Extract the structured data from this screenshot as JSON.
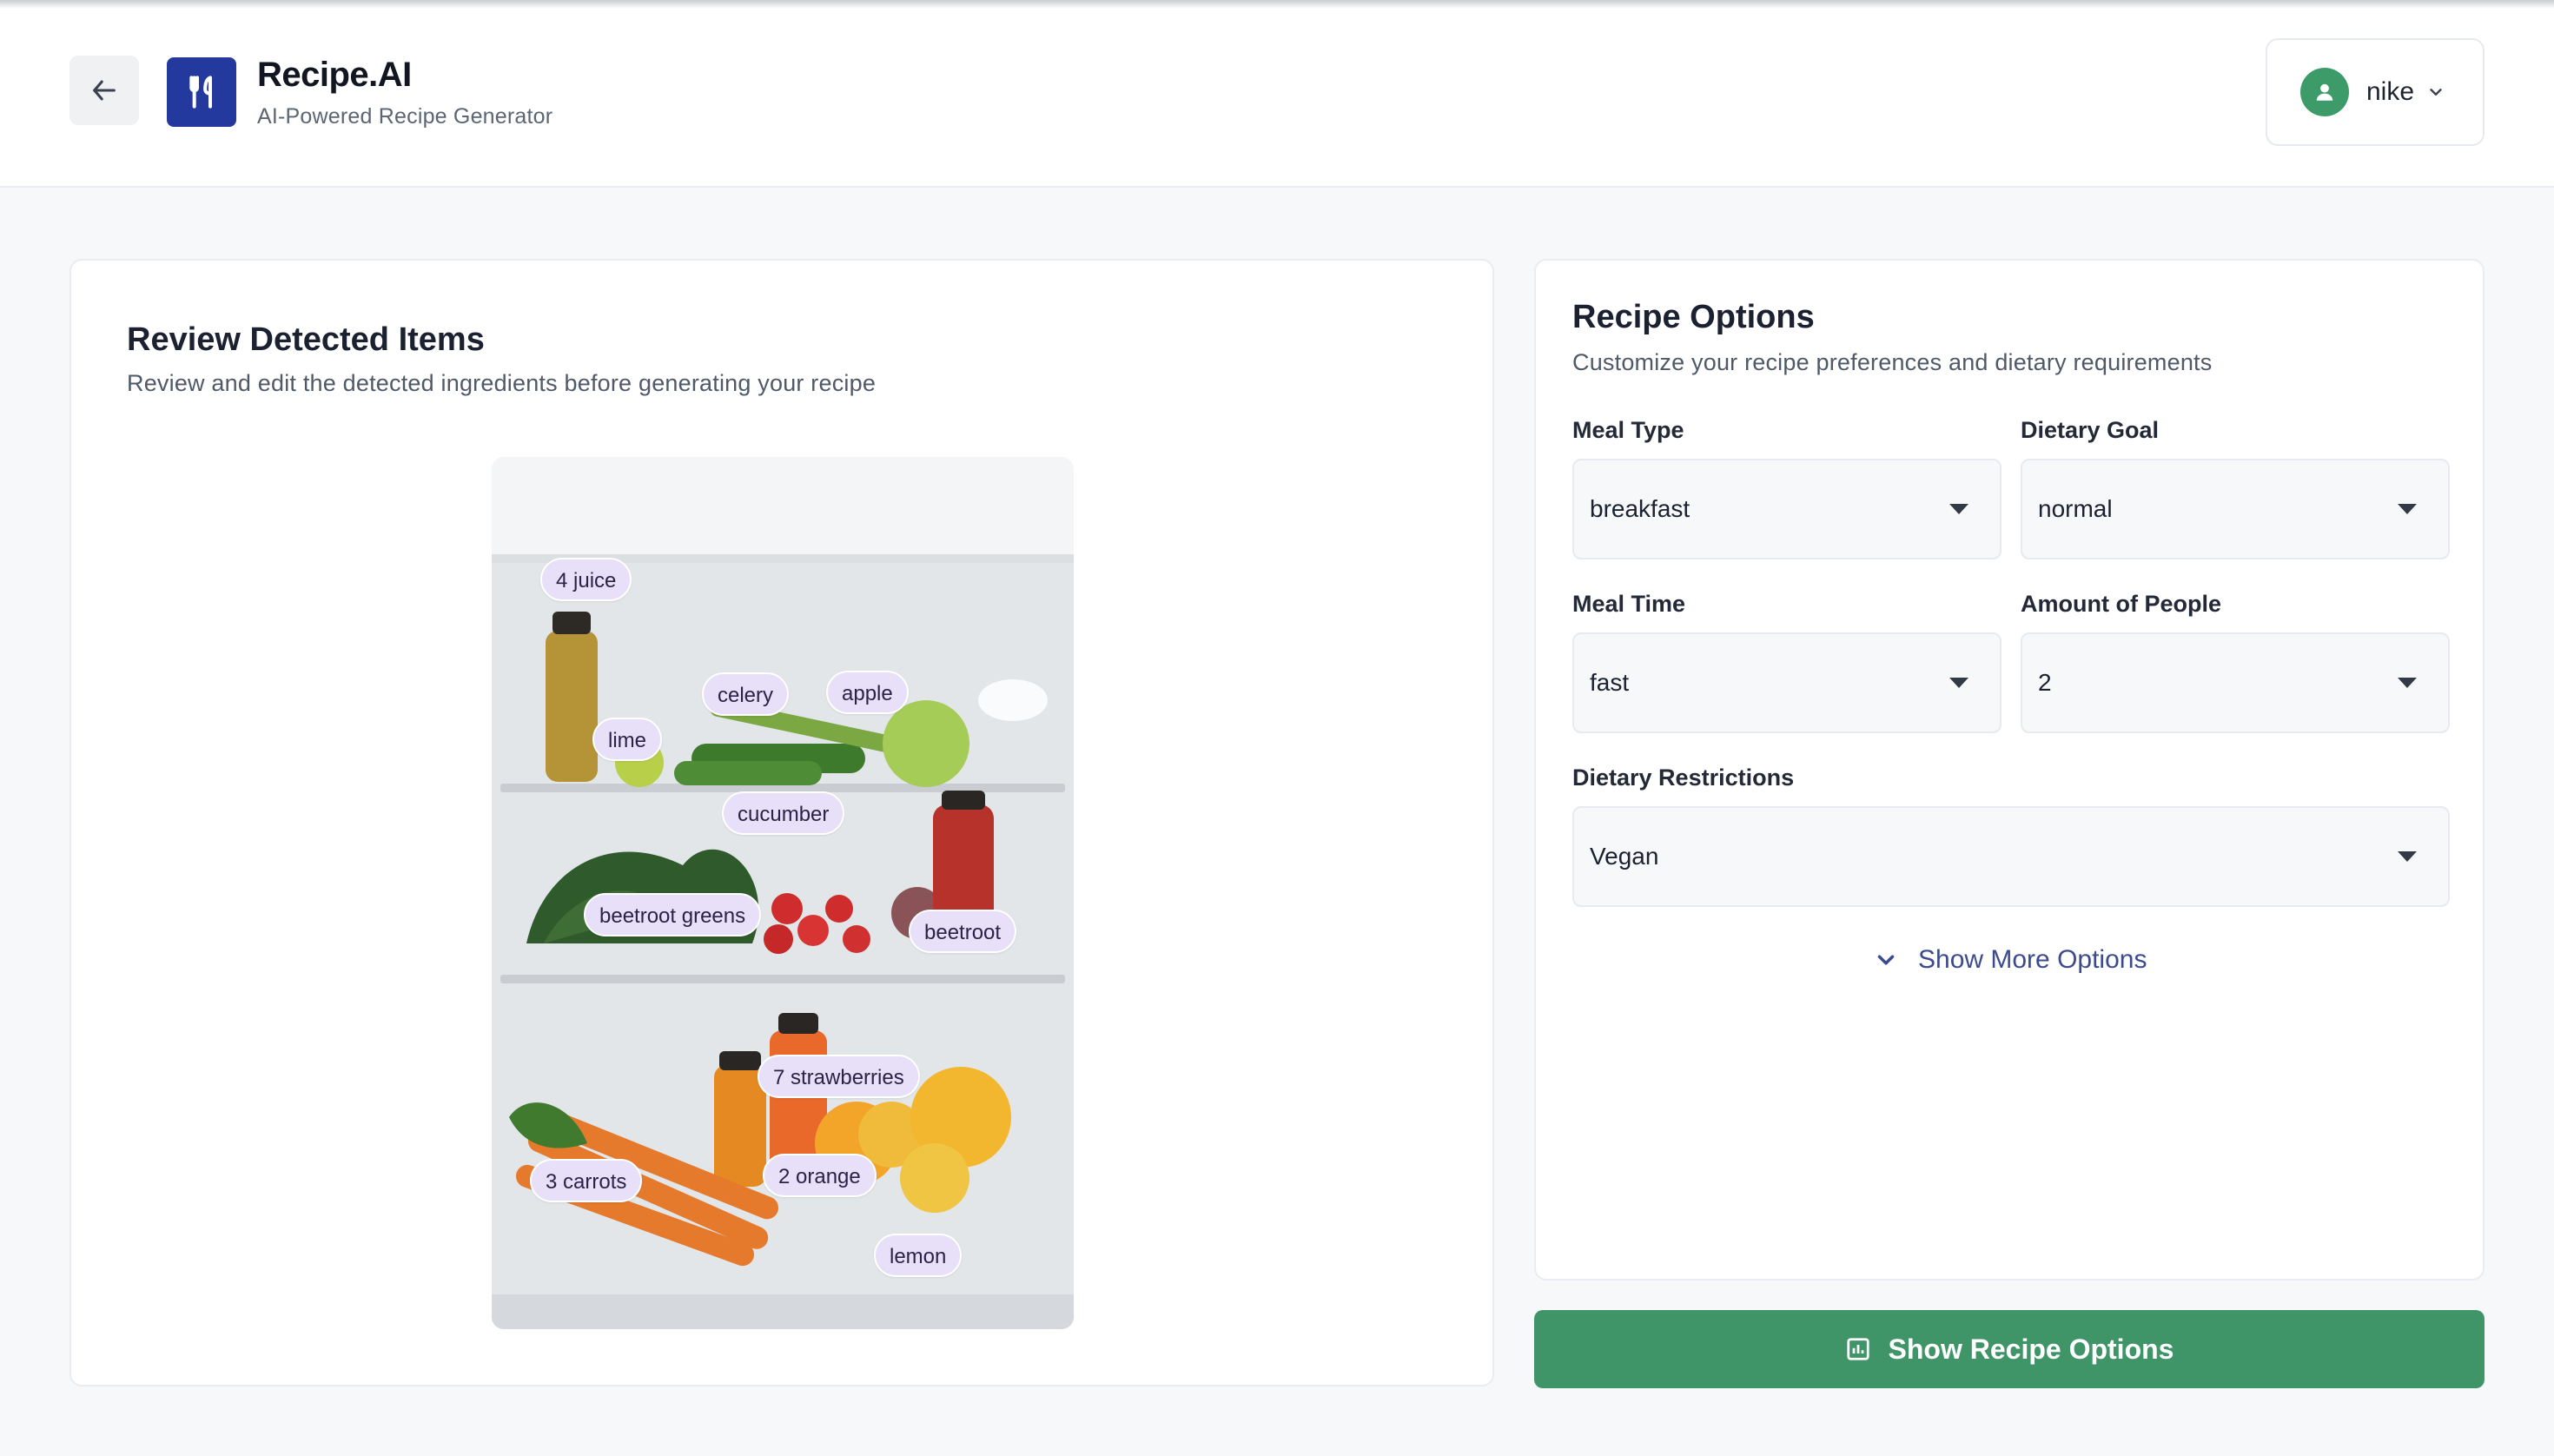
{
  "header": {
    "app_name": "Recipe.AI",
    "app_subtitle": "AI-Powered Recipe Generator",
    "back_icon": "arrow-left-icon",
    "logo_icon": "utensils-icon",
    "user": {
      "name": "nike",
      "avatar_icon": "user-icon",
      "menu_icon": "chevron-down-icon"
    }
  },
  "review": {
    "title": "Review Detected Items",
    "subtitle": "Review and edit the detected ingredients before generating your recipe",
    "image_description": "fridge-contents-photo",
    "tags": [
      {
        "label": "4 juice"
      },
      {
        "label": "celery"
      },
      {
        "label": "apple"
      },
      {
        "label": "lime"
      },
      {
        "label": "cucumber"
      },
      {
        "label": "beetroot greens"
      },
      {
        "label": "beetroot"
      },
      {
        "label": "7 strawberries"
      },
      {
        "label": "2 orange"
      },
      {
        "label": "3 carrots"
      },
      {
        "label": "lemon"
      }
    ]
  },
  "options": {
    "title": "Recipe Options",
    "subtitle": "Customize your recipe preferences and dietary requirements",
    "meal_type": {
      "label": "Meal Type",
      "value": "breakfast"
    },
    "dietary_goal": {
      "label": "Dietary Goal",
      "value": "normal"
    },
    "meal_time": {
      "label": "Meal Time",
      "value": "fast"
    },
    "people": {
      "label": "Amount of People",
      "value": "2"
    },
    "restrictions": {
      "label": "Dietary Restrictions",
      "value": "Vegan"
    },
    "more_options": "Show More Options"
  },
  "primary_button": {
    "label": "Show Recipe Options",
    "icon": "chart-icon"
  },
  "colors": {
    "brand": "#23399e",
    "primary": "#3f9568",
    "tag_bg": "#e8e0f8",
    "link": "#3c4b8e"
  }
}
